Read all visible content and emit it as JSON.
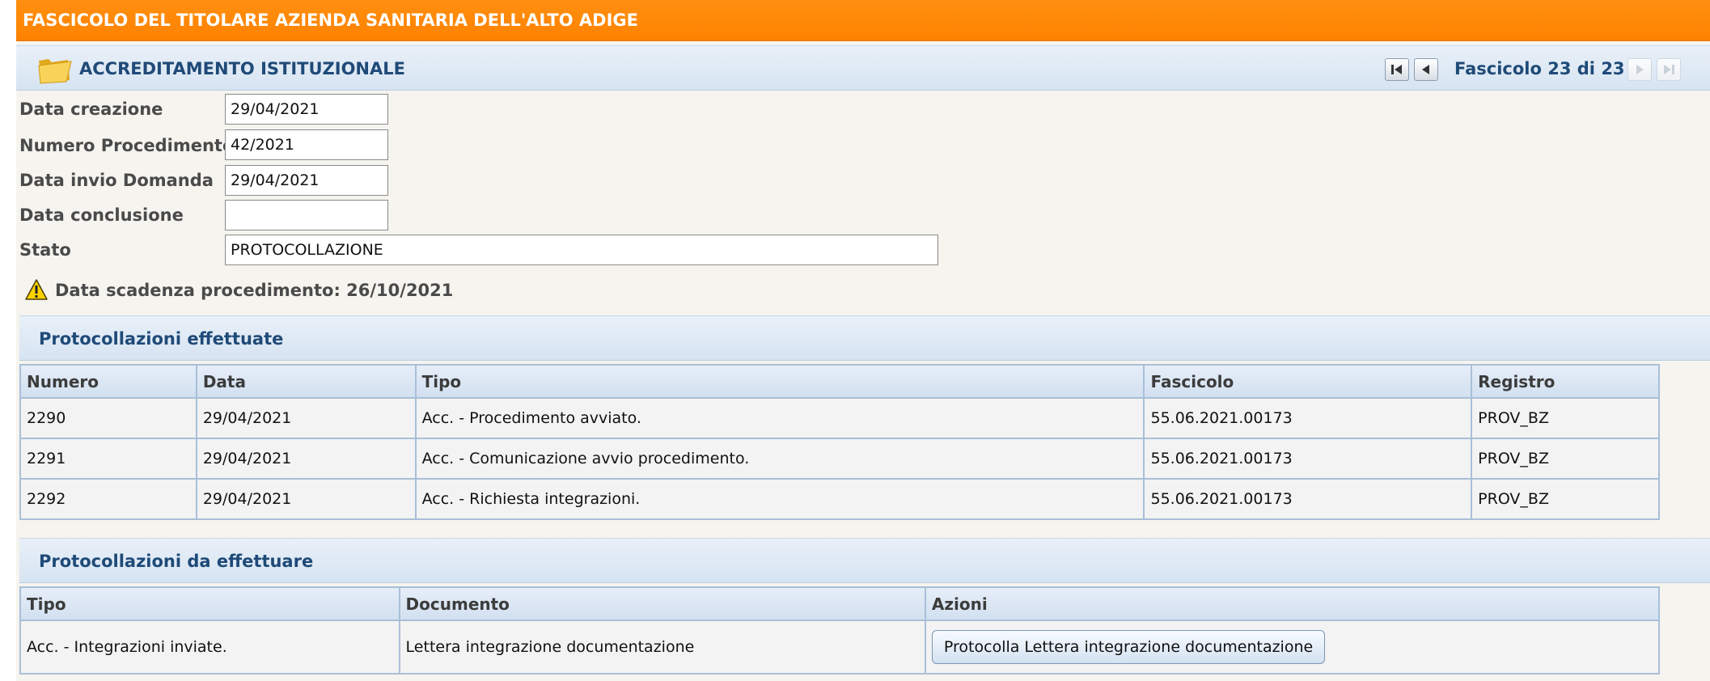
{
  "header": {
    "title": "FASCICOLO DEL TITOLARE AZIENDA SANITARIA DELL'ALTO ADIGE"
  },
  "section": {
    "title": "ACCREDITAMENTO ISTITUZIONALE",
    "icon": "folder-icon",
    "pager": {
      "text": "Fascicolo 23 di 23",
      "current": 23,
      "total": 23
    }
  },
  "form": {
    "data_creazione": {
      "label": "Data creazione",
      "value": "29/04/2021"
    },
    "numero_procedimento": {
      "label": "Numero Procedimento",
      "value": "42/2021"
    },
    "data_invio_domanda": {
      "label": "Data invio Domanda",
      "value": "29/04/2021"
    },
    "data_conclusione": {
      "label": "Data conclusione",
      "value": ""
    },
    "stato": {
      "label": "Stato",
      "value": "PROTOCOLLAZIONE"
    }
  },
  "deadline": {
    "icon": "warning-icon",
    "text": "Data scadenza procedimento: 26/10/2021"
  },
  "protocollazioni_effettuate": {
    "title": "Protocollazioni effettuate",
    "columns": [
      "Numero",
      "Data",
      "Tipo",
      "Fascicolo",
      "Registro"
    ],
    "rows": [
      [
        "2290",
        "29/04/2021",
        "Acc. - Procedimento avviato.",
        "55.06.2021.00173",
        "PROV_BZ"
      ],
      [
        "2291",
        "29/04/2021",
        "Acc. - Comunicazione avvio procedimento.",
        "55.06.2021.00173",
        "PROV_BZ"
      ],
      [
        "2292",
        "29/04/2021",
        "Acc. - Richiesta integrazioni.",
        "55.06.2021.00173",
        "PROV_BZ"
      ]
    ]
  },
  "protocollazioni_da_effettuare": {
    "title": "Protocollazioni da effettuare",
    "columns": [
      "Tipo",
      "Documento",
      "Azioni"
    ],
    "rows": [
      {
        "tipo": "Acc. - Integrazioni inviate.",
        "documento": "Lettera integrazione documentazione",
        "azione": "Protocolla Lettera integrazione documentazione"
      }
    ]
  },
  "colors": {
    "header": "#ff8200",
    "section_bg": "#dde8f4",
    "title_blue": "#1f4a78",
    "page_bg": "#f6f4ee"
  }
}
